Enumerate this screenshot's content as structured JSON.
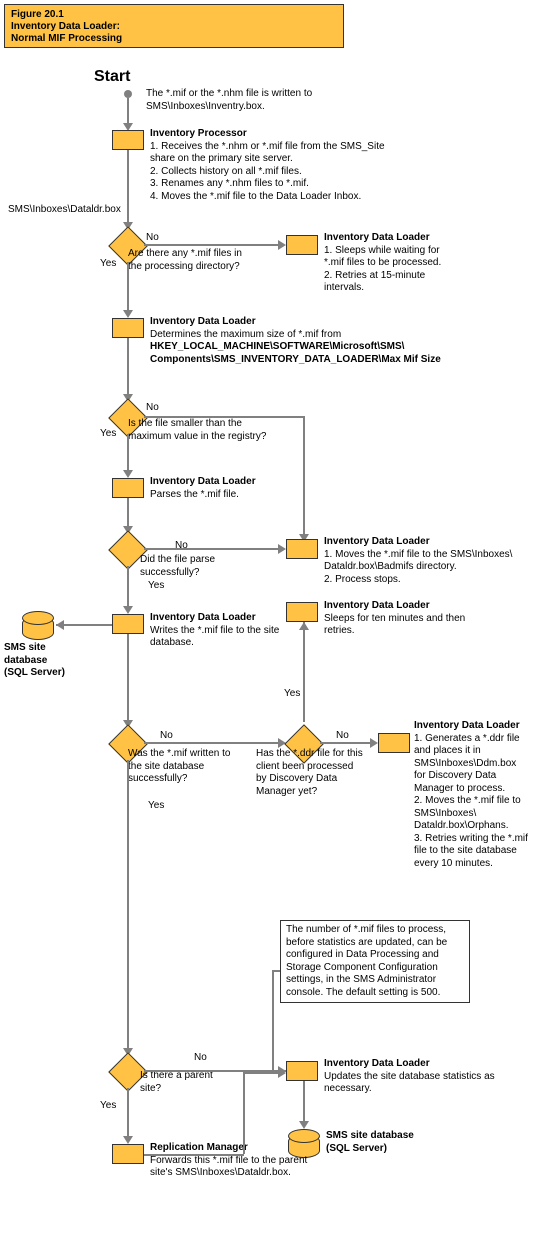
{
  "title": {
    "line1": "Figure 20.1",
    "line2": "Inventory Data Loader:",
    "line3": "Normal MIF Processing"
  },
  "start": "Start",
  "startNote": "The *.mif or the *.nhm file is written to SMS\\Inboxes\\Inventry.box.",
  "n1": {
    "title": "Inventory Processor",
    "l1": "1. Receives the *.nhm or *.mif file from the SMS_Site",
    "l1b": "    share on the primary site server.",
    "l2": "2. Collects history on all *.mif files.",
    "l3": "3. Renames any *.nhm files to *.mif.",
    "l4": "4. Moves the *.mif file to the Data Loader Inbox."
  },
  "path1": "SMS\\Inboxes\\Dataldr.box",
  "d1": {
    "no": "No",
    "yes": "Yes",
    "q": "Are there any *.mif  files in the processing directory?"
  },
  "n2": {
    "title": "Inventory Data Loader",
    "l1": "1. Sleeps while waiting for",
    "l1b": "    *.mif files to be processed.",
    "l2": "2. Retries at 15-minute",
    "l2b": "    intervals."
  },
  "n3": {
    "title": "Inventory Data Loader",
    "l1": "Determines the maximum size of *.mif from",
    "l2": "HKEY_LOCAL_MACHINE\\SOFTWARE\\Microsoft\\SMS\\",
    "l3": "Components\\SMS_INVENTORY_DATA_LOADER\\Max Mif Size"
  },
  "d2": {
    "no": "No",
    "yes": "Yes",
    "q": "Is the file smaller than the maximum value in the registry?"
  },
  "n4": {
    "title": "Inventory Data Loader",
    "l1": "Parses the *.mif file."
  },
  "d3": {
    "no": "No",
    "yes": "Yes",
    "q": "Did the file parse successfully?"
  },
  "n5": {
    "title": "Inventory Data Loader",
    "l1": "1. Moves the *.mif file to the SMS\\Inboxes\\",
    "l1b": "    Dataldr.box\\Badmifs directory.",
    "l2": "2. Process stops."
  },
  "db1": {
    "l1": "SMS site",
    "l2": "database",
    "l3": "(SQL Server)"
  },
  "n6": {
    "title": "Inventory Data Loader",
    "l1": "Writes the *.mif file to the site database."
  },
  "n7": {
    "title": "Inventory Data Loader",
    "l1": "Sleeps for ten minutes and then retries."
  },
  "d4": {
    "no": "No",
    "yes": "Yes",
    "q": "Was the *.mif written to the site database successfully?"
  },
  "d5": {
    "no": "No",
    "yes": "Yes",
    "q": "Has the *.ddr file for this client been processed by Discovery Data Manager yet?"
  },
  "n8": {
    "title": "Inventory Data Loader",
    "l1": "1. Generates a *.ddr file",
    "l1b": "    and places it in",
    "l1c": "    SMS\\Inboxes\\Ddm.box",
    "l1d": "    for Discovery Data",
    "l1e": "    Manager to process.",
    "l2": "2. Moves the *.mif file to",
    "l2b": "    SMS\\Inboxes\\",
    "l2c": "    Dataldr.box\\Orphans.",
    "l3": "3. Retries writing the *.mif",
    "l3b": "    file to the site database",
    "l3c": "    every 10 minutes."
  },
  "note": "The number of *.mif files to process, before statistics are updated, can be configured in Data Processing and Storage Component Configuration settings, in the SMS Administrator console. The default setting is 500.",
  "d6": {
    "no": "No",
    "yes": "Yes",
    "q": "Is there a parent site?"
  },
  "n9": {
    "title": "Inventory Data Loader",
    "l1": "Updates the site database statistics as necessary."
  },
  "db2": {
    "l1": "SMS site database",
    "l2": "(SQL Server)"
  },
  "n10": {
    "title": "Replication Manager",
    "l1": "Forwards this *.mif file to the parent site's SMS\\Inboxes\\Dataldr.box."
  }
}
